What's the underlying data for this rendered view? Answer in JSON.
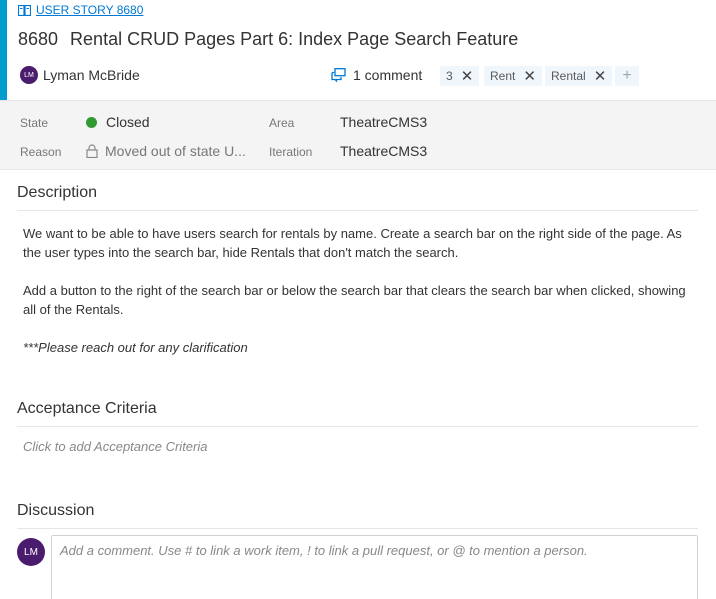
{
  "work_item": {
    "type_label": "USER STORY 8680",
    "id": "8680",
    "title": "Rental CRUD Pages Part 6: Index Page Search Feature",
    "assignee": {
      "name": "Lyman McBride",
      "initials": "LM"
    },
    "comments_label": "1 comment",
    "tags": [
      "3",
      "Rent",
      "Rental"
    ],
    "accent_color": "#009ccc"
  },
  "fields": {
    "state": {
      "label": "State",
      "value": "Closed",
      "color": "#339933"
    },
    "reason": {
      "label": "Reason",
      "value": "Moved out of state U..."
    },
    "area": {
      "label": "Area",
      "value": "TheatreCMS3"
    },
    "iteration": {
      "label": "Iteration",
      "value": "TheatreCMS3"
    }
  },
  "description": {
    "heading": "Description",
    "paragraphs": [
      "We want to be able to have users search for rentals by name.  Create a search bar on the right side of the page.  As the user types into the search bar, hide Rentals that don't match the search.",
      "Add a button to the right of the search bar or below the search bar that clears the search bar when clicked, showing all of the Rentals.",
      "***Please reach out for any clarification"
    ]
  },
  "acceptance": {
    "heading": "Acceptance Criteria",
    "placeholder": "Click to add Acceptance Criteria"
  },
  "discussion": {
    "heading": "Discussion",
    "avatar_initials": "LM",
    "placeholder": "Add a comment. Use # to link a work item, ! to link a pull request, or @ to mention a person."
  }
}
